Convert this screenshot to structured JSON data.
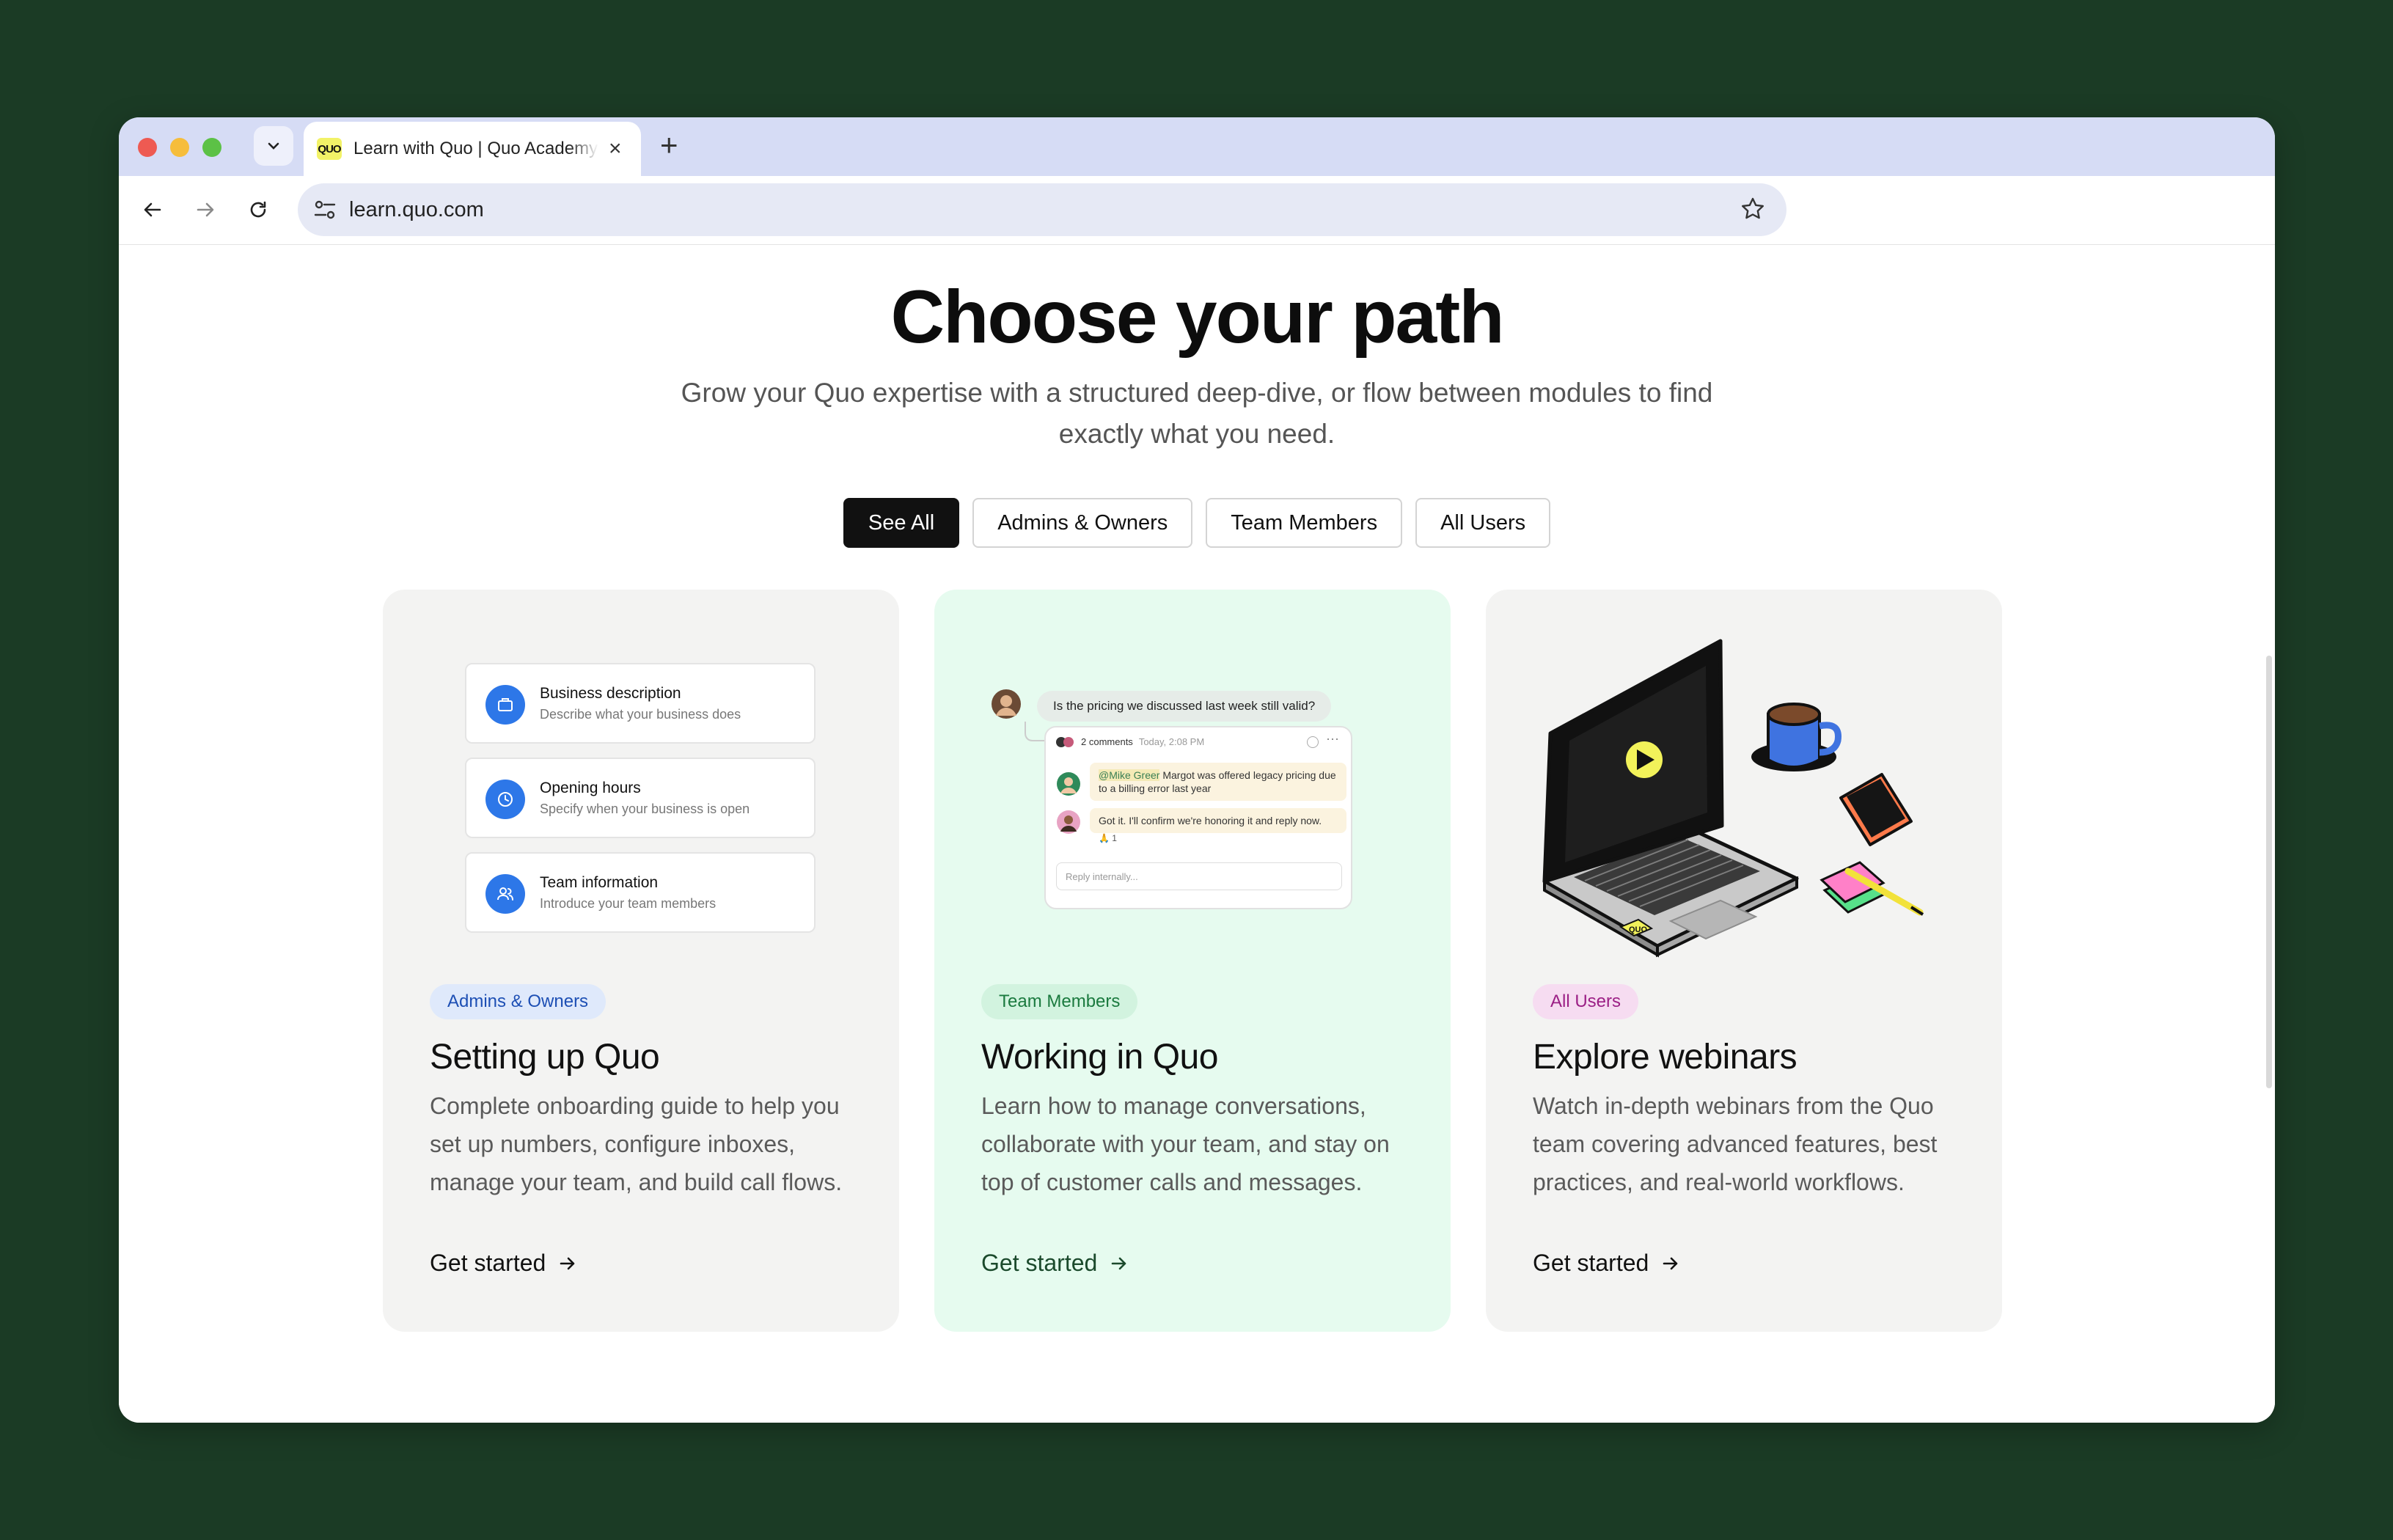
{
  "browser": {
    "tab_title": "Learn with Quo | Quo Academy",
    "favicon_text": "QUO",
    "url": "learn.quo.com"
  },
  "hero": {
    "title": "Choose your path",
    "subtitle": "Grow your Quo expertise with a structured deep-dive, or flow between modules to find exactly what you need."
  },
  "filters": [
    {
      "label": "See All",
      "active": true
    },
    {
      "label": "Admins & Owners",
      "active": false
    },
    {
      "label": "Team Members",
      "active": false
    },
    {
      "label": "All Users",
      "active": false
    }
  ],
  "cards": [
    {
      "badge": "Admins & Owners",
      "title": "Setting up Quo",
      "description": "Complete onboarding guide to help you set up numbers, configure inboxes, manage your team, and build call flows.",
      "cta": "Get started",
      "fields": [
        {
          "title": "Business description",
          "subtitle": "Describe what your business does"
        },
        {
          "title": "Opening hours",
          "subtitle": "Specify when your business is open"
        },
        {
          "title": "Team information",
          "subtitle": "Introduce your team members"
        }
      ]
    },
    {
      "badge": "Team Members",
      "title": "Working in Quo",
      "description": "Learn how to manage conversations, collaborate with your team, and stay on top of customer calls and messages.",
      "cta": "Get started",
      "chat": {
        "question": "Is the pricing we discussed last week still valid?",
        "comments_count": "2 comments",
        "time": "Today, 2:08 PM",
        "mention": "@Mike Greer",
        "message1": " Margot was offered legacy pricing due to a billing error last year",
        "message2": "Got it. I'll confirm we're honoring it and reply now.",
        "reaction": "🙏 1",
        "reply_placeholder": "Reply internally..."
      }
    },
    {
      "badge": "All Users",
      "title": "Explore webinars",
      "description": "Watch in-depth webinars from the Quo team covering advanced features, best practices, and real-world workflows.",
      "cta": "Get started",
      "sticker_text": "QUO"
    }
  ]
}
